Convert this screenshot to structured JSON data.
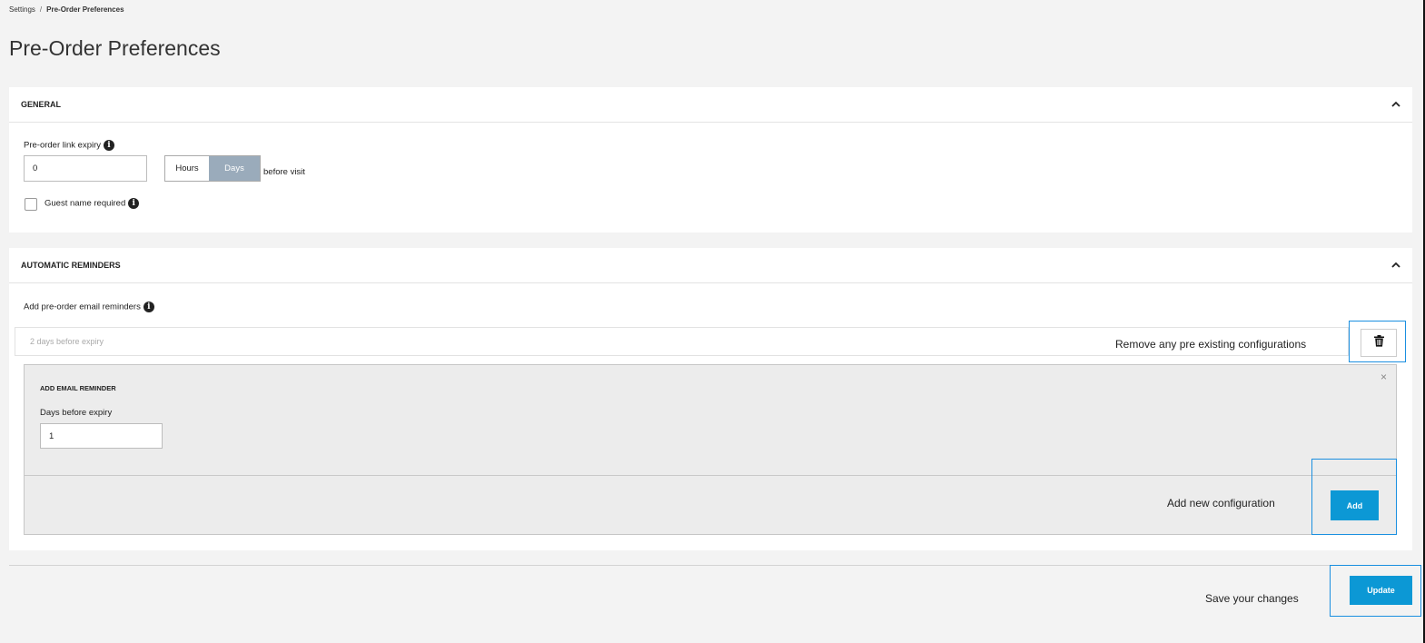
{
  "breadcrumb": {
    "root": "Settings",
    "separator": "/",
    "current": "Pre-Order Preferences"
  },
  "page": {
    "title": "Pre-Order Preferences"
  },
  "general": {
    "title": "GENERAL",
    "collapse_icon": "chevron-up-icon",
    "link_expiry": {
      "label": "Pre-order link expiry",
      "value": "0",
      "unit_options": [
        "Hours",
        "Days"
      ],
      "selected_unit": "Days",
      "suffix": "before visit"
    },
    "guest_name_required": {
      "label": "Guest name required",
      "checked": false
    }
  },
  "reminders": {
    "title": "AUTOMATIC REMINDERS",
    "collapse_icon": "chevron-up-icon",
    "label": "Add pre-order email reminders",
    "existing": [
      {
        "text": "2 days before expiry"
      }
    ],
    "remove_hint": "Remove any pre existing configurations",
    "add_form": {
      "title": "ADD EMAIL REMINDER",
      "field_label": "Days before expiry",
      "field_value": "1",
      "close_icon": "×",
      "add_hint": "Add new configuration",
      "add_label": "Add"
    }
  },
  "footer": {
    "save_hint": "Save your changes",
    "update_label": "Update"
  },
  "colors": {
    "primary": "#0c98d5",
    "highlight": "#1a8fe0",
    "segment_active": "#9aabbb"
  }
}
